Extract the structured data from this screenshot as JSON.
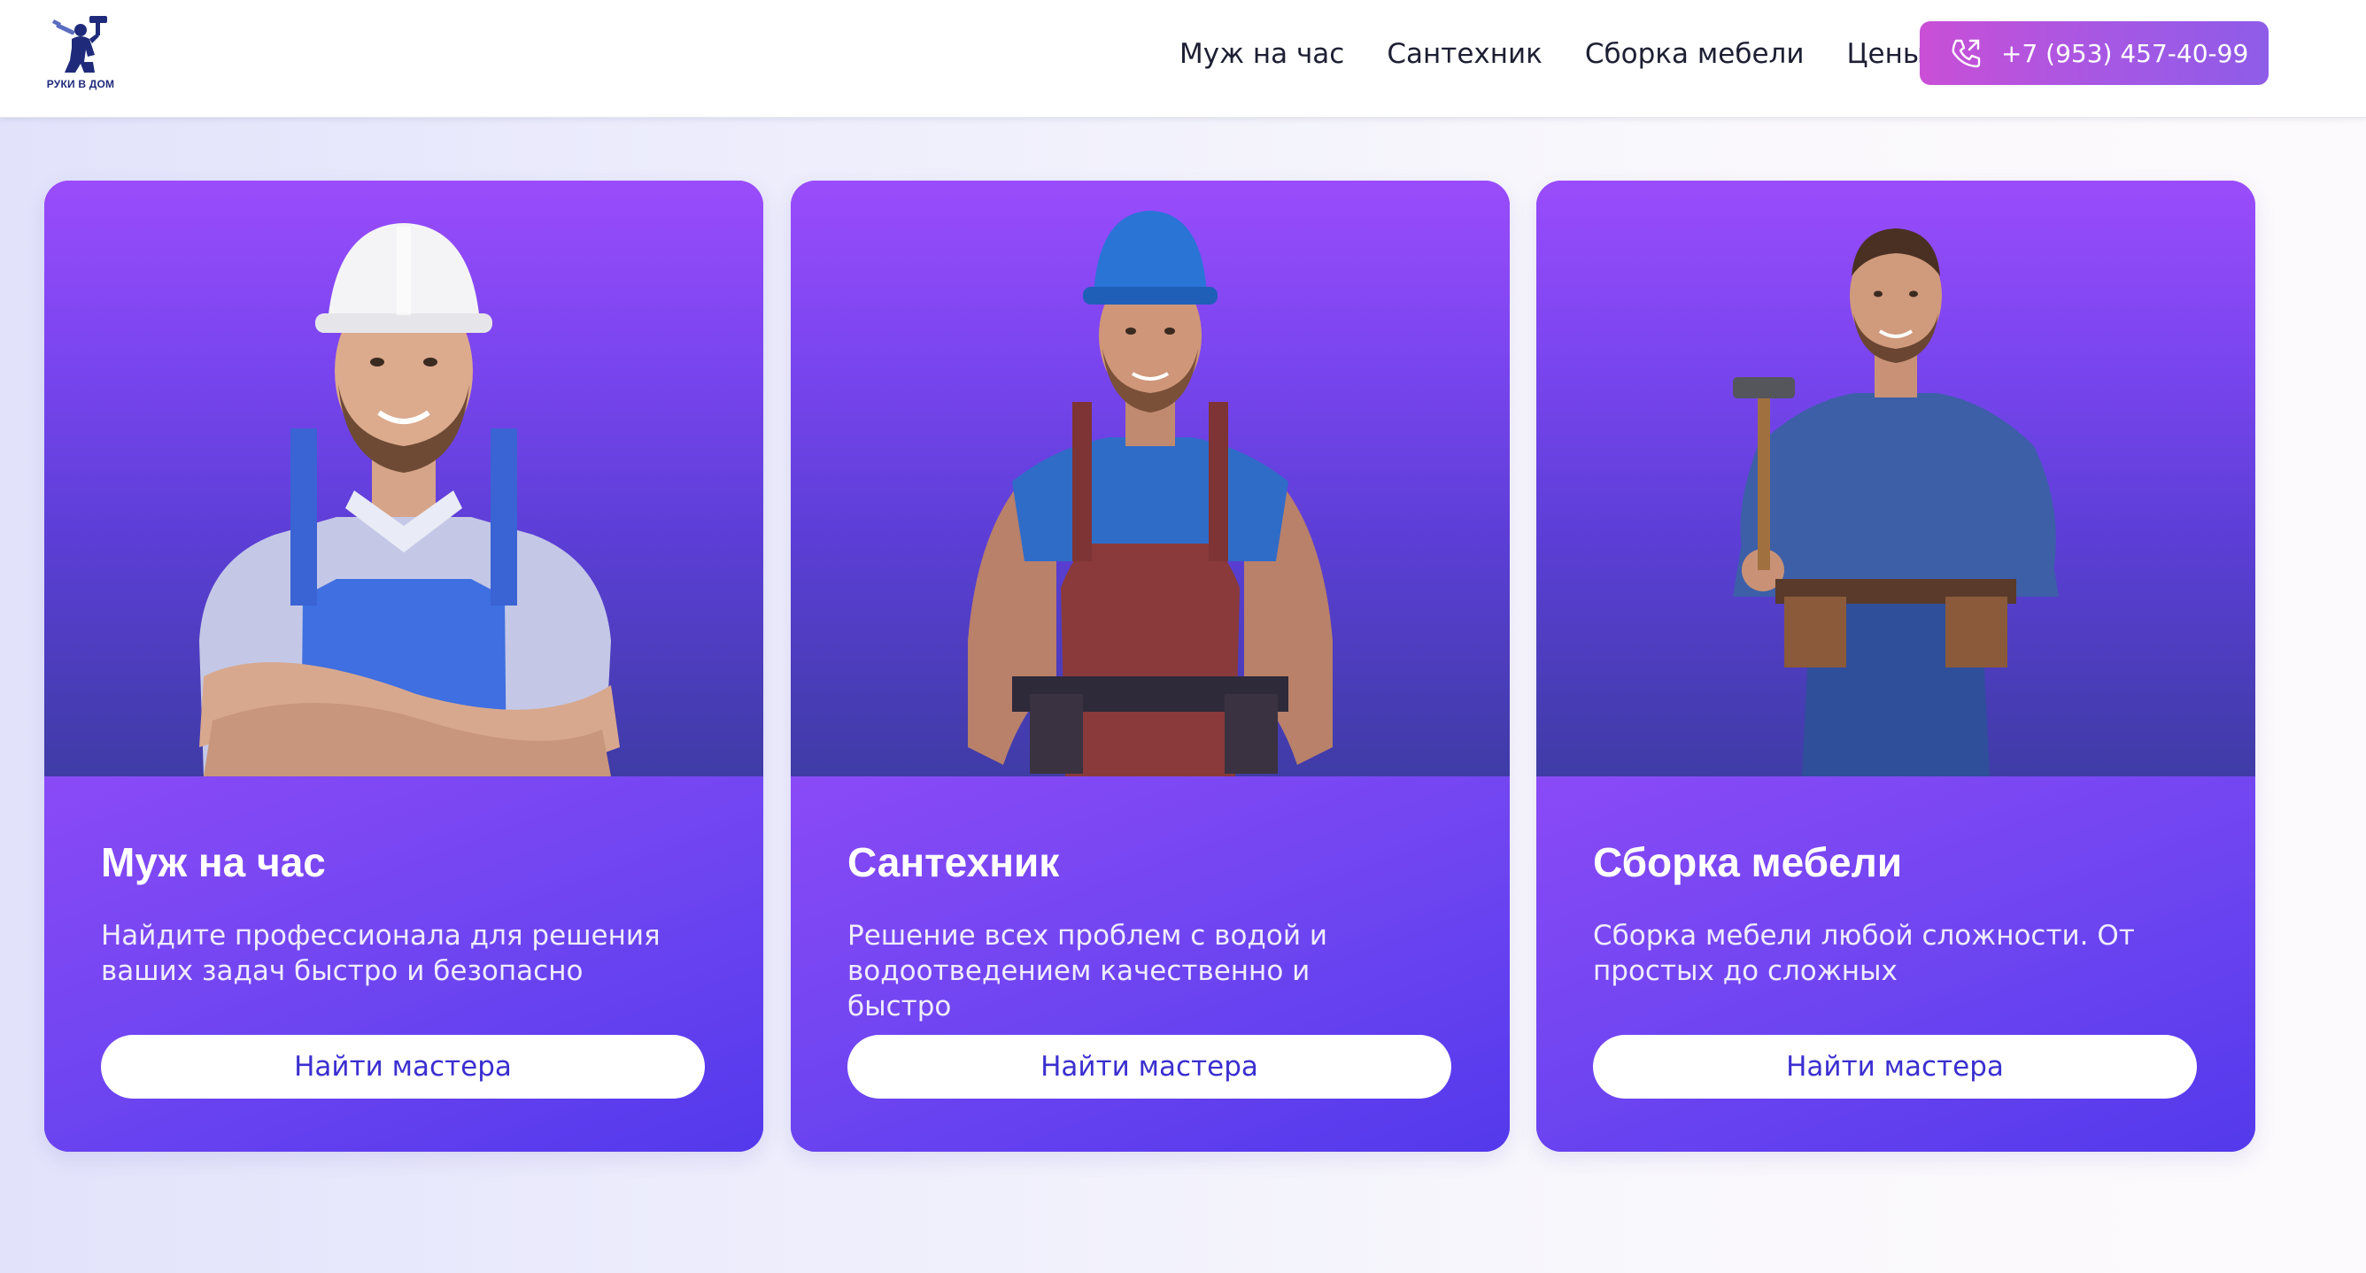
{
  "header": {
    "logo": {
      "text": "РУКИ В ДОМ",
      "icon": "handyman-logo-icon"
    },
    "nav": [
      {
        "label": "Муж на час"
      },
      {
        "label": "Сантехник"
      },
      {
        "label": "Сборка мебели"
      },
      {
        "label": "Цены"
      }
    ],
    "phone": {
      "label": "+7 (953) 457-40-99",
      "icon": "phone-icon"
    }
  },
  "cards": [
    {
      "title": "Муж на час",
      "description": "Найдите профессионала для решения ваших задач быстро и безопасно",
      "button": "Найти мастера",
      "image": "handyman-white-helmet-photo"
    },
    {
      "title": "Сантехник",
      "description": "Решение всех проблем с водой и водоотведением качественно и быстро",
      "button": "Найти мастера",
      "image": "plumber-blue-helmet-photo"
    },
    {
      "title": "Сборка мебели",
      "description": "Сборка мебели любой сложности. От простых до сложных",
      "button": "Найти мастера",
      "image": "furniture-assembler-hammer-photo"
    }
  ],
  "colors": {
    "accent_gradient_start": "#c94fd6",
    "accent_gradient_end": "#8e5ce8",
    "card_purple": "#7444f0",
    "button_text": "#3b2fd0"
  }
}
